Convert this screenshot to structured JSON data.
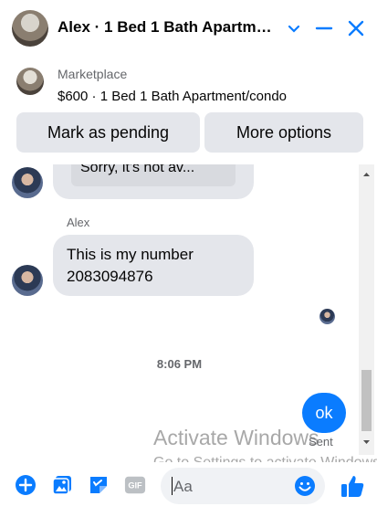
{
  "header": {
    "title": "Alex · 1 Bed 1 Bath Apartm…",
    "chevron_icon": "chevron-down-icon",
    "minimize_icon": "minimize-icon",
    "close_icon": "close-icon"
  },
  "marketplace": {
    "label": "Marketplace",
    "listing": "$600 · 1 Bed 1 Bath Apartment/condo",
    "mark_pending_label": "Mark as pending",
    "more_options_label": "More options"
  },
  "conversation": {
    "quoted_partial": "Sorry, it's not av...",
    "sender_name": "Alex",
    "message_line1": "This is my number",
    "message_line2": "2083094876",
    "timestamp": "8:06 PM",
    "sent_message": "ok",
    "sent_status": "Sent"
  },
  "composer": {
    "placeholder": "Aa",
    "icons": [
      "plus-icon",
      "image-icon",
      "sticker-icon",
      "gif-icon",
      "emoji-icon",
      "thumbs-up-icon"
    ],
    "gif_label": "GIF"
  },
  "watermark": {
    "line1": "Activate Windows",
    "line2": "Go to Settings to activate Windows."
  },
  "colors": {
    "accent": "#0a7cff",
    "bubble_incoming": "#e4e6eb",
    "secondary_text": "#65676b"
  }
}
